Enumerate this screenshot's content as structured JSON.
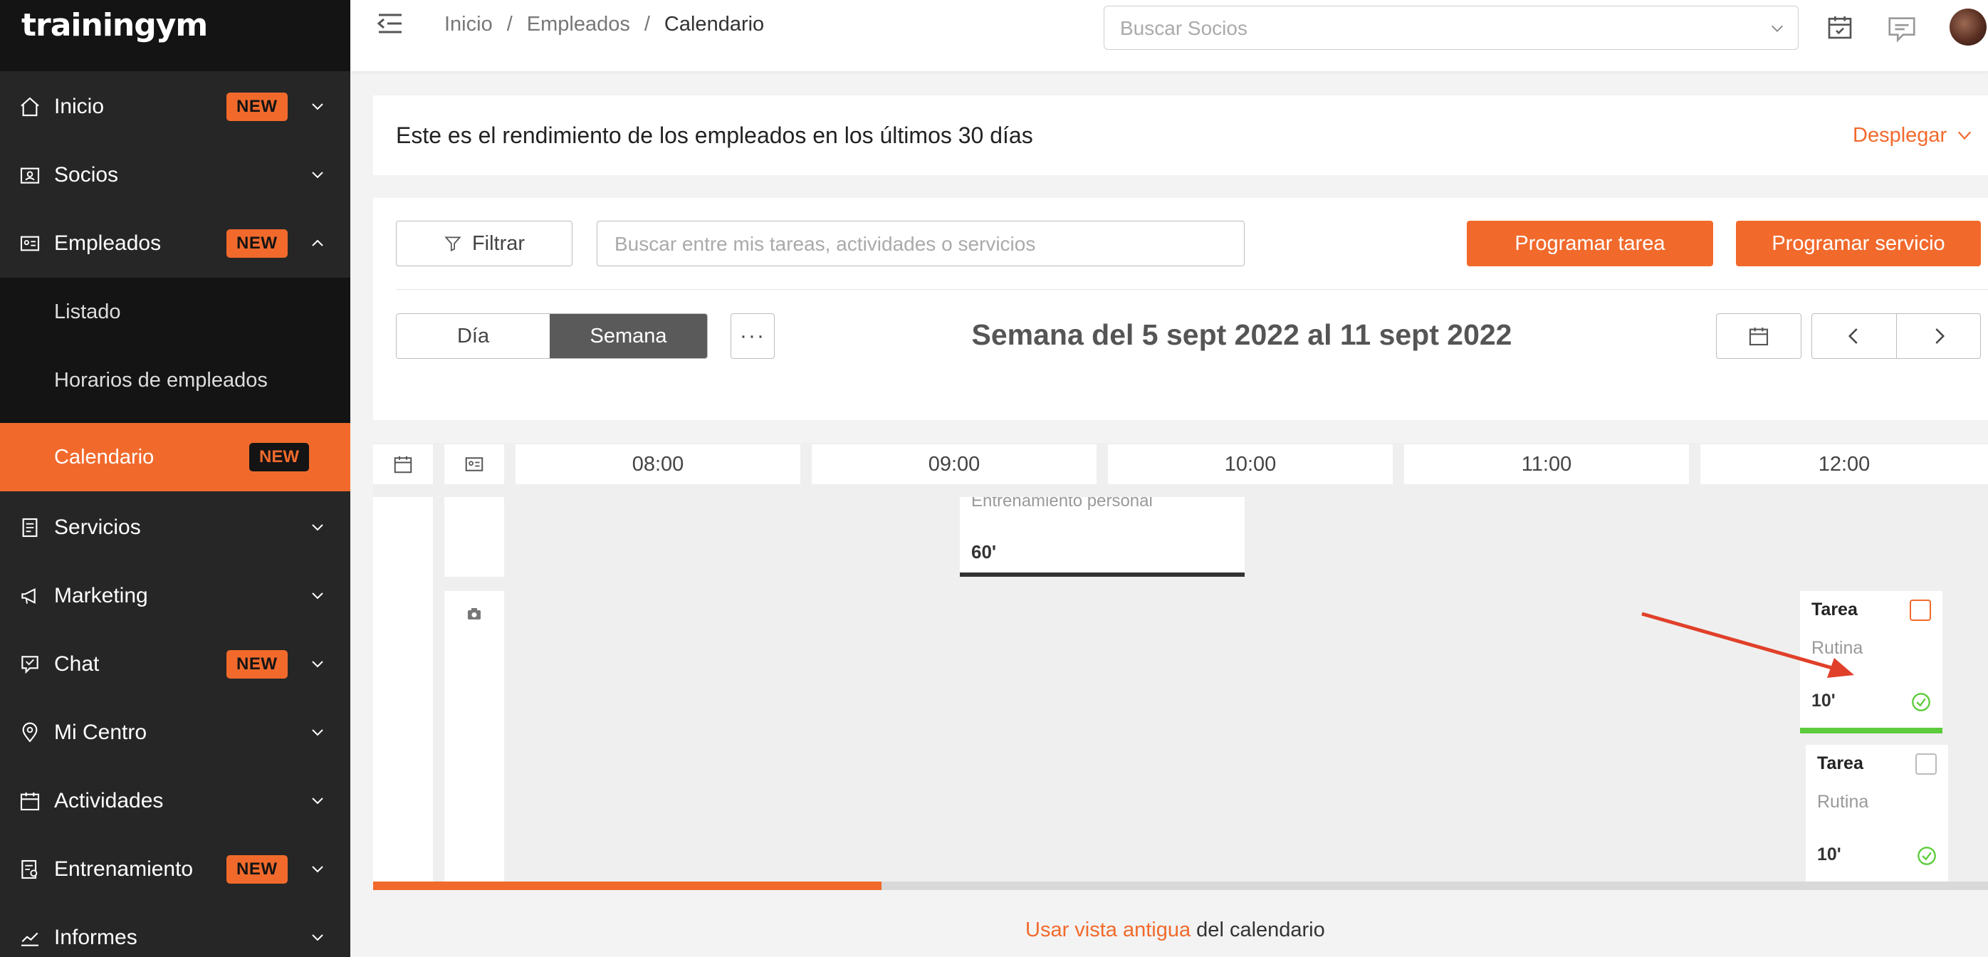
{
  "app": {
    "logo": "trainingym"
  },
  "sidebar": {
    "items": [
      {
        "label": "Inicio",
        "badge": "NEW",
        "icon": "home-icon"
      },
      {
        "label": "Socios",
        "badge": "",
        "icon": "member-card-icon"
      },
      {
        "label": "Empleados",
        "badge": "NEW",
        "icon": "id-card-icon"
      },
      {
        "label": "Servicios",
        "badge": "",
        "icon": "document-icon"
      },
      {
        "label": "Marketing",
        "badge": "",
        "icon": "megaphone-icon"
      },
      {
        "label": "Chat",
        "badge": "NEW",
        "icon": "chat-icon"
      },
      {
        "label": "Mi Centro",
        "badge": "",
        "icon": "location-pin-icon"
      },
      {
        "label": "Actividades",
        "badge": "",
        "icon": "calendar-icon"
      },
      {
        "label": "Entrenamiento",
        "badge": "NEW",
        "icon": "training-icon"
      },
      {
        "label": "Informes",
        "badge": "",
        "icon": "chart-line-icon"
      }
    ],
    "submenu": [
      {
        "label": "Listado"
      },
      {
        "label": "Horarios de empleados"
      },
      {
        "label": "Calendario",
        "badge": "NEW",
        "active": true
      }
    ]
  },
  "topbar": {
    "breadcrumb": [
      "Inicio",
      "Empleados",
      "Calendario"
    ],
    "separator": "/",
    "search_placeholder": "Buscar Socios"
  },
  "banner": {
    "text": "Este es el rendimiento de los empleados en los últimos 30 días",
    "toggle": "Desplegar"
  },
  "toolbar": {
    "filter_label": "Filtrar",
    "search_placeholder": "Buscar entre mis tareas, actividades o servicios",
    "schedule_task": "Programar tarea",
    "schedule_service": "Programar servicio",
    "view_day": "Día",
    "view_week": "Semana",
    "more": "···",
    "week_title": "Semana del 5 sept 2022 al 11 sept 2022"
  },
  "calendar": {
    "hours": [
      "08:00",
      "09:00",
      "10:00",
      "11:00",
      "12:00"
    ],
    "event": {
      "name": "Entrenamiento personal",
      "duration": "60'"
    },
    "tasks": [
      {
        "title": "Tarea",
        "subtitle": "Rutina",
        "duration": "10'",
        "status_color": "#5ccc3c"
      },
      {
        "title": "Tarea",
        "subtitle": "Rutina",
        "duration": "10'"
      }
    ]
  },
  "footer": {
    "link": "Usar vista antigua",
    "text": " del calendario"
  },
  "colors": {
    "accent": "#f16a2c",
    "sidebar_bg": "#262626",
    "success": "#5ccc3c",
    "annotation_arrow": "#e0402a"
  }
}
